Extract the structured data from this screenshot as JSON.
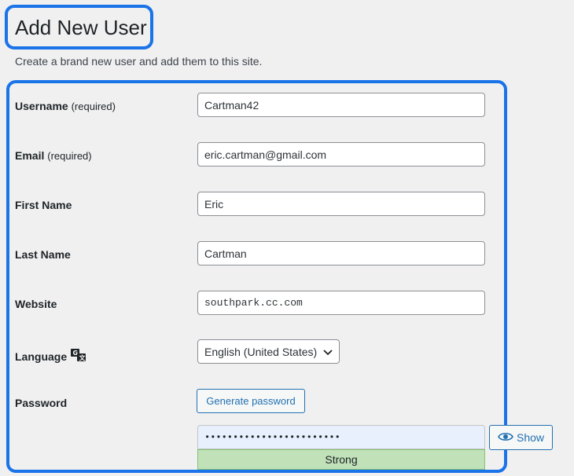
{
  "header": {
    "title": "Add New User",
    "description": "Create a brand new user and add them to this site."
  },
  "form": {
    "username": {
      "label": "Username",
      "required": "(required)",
      "value": "Cartman42"
    },
    "email": {
      "label": "Email",
      "required": "(required)",
      "value": "eric.cartman@gmail.com"
    },
    "first_name": {
      "label": "First Name",
      "value": "Eric"
    },
    "last_name": {
      "label": "Last Name",
      "value": "Cartman"
    },
    "website": {
      "label": "Website",
      "value": "southpark.cc.com"
    },
    "language": {
      "label": "Language",
      "value": "English (United States)",
      "icon": "translation-icon"
    },
    "password": {
      "label": "Password",
      "generate_label": "Generate password",
      "masked_value": "••••••••••••••••••••••••",
      "show_label": "Show",
      "strength": "Strong",
      "strength_color": "#c1e1b9"
    }
  },
  "colors": {
    "highlight": "#1a73e8",
    "accent": "#2271b1",
    "background": "#f0f0f1"
  }
}
